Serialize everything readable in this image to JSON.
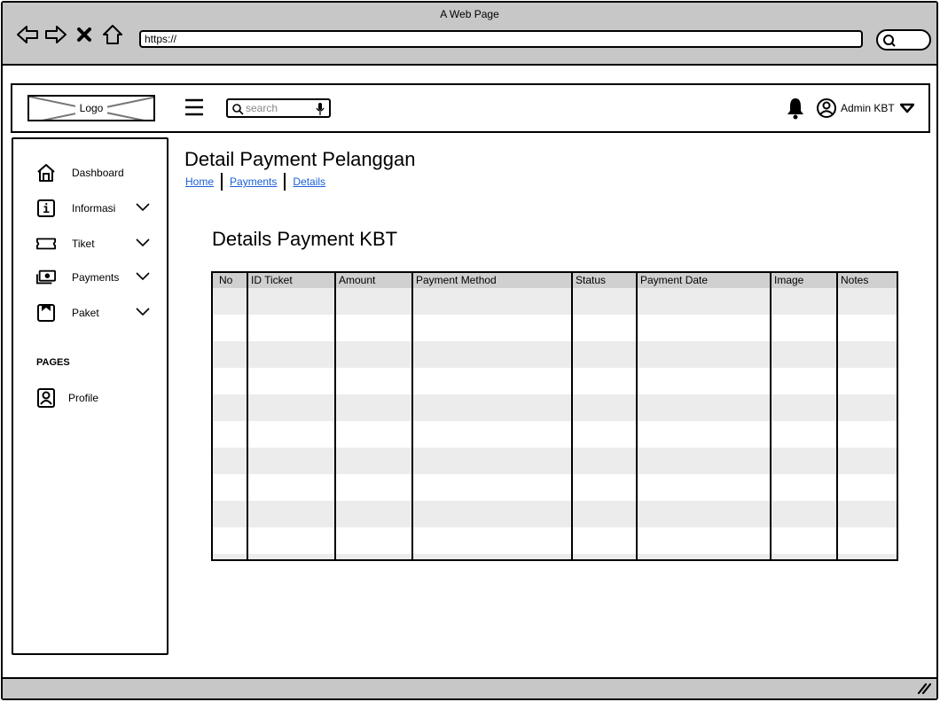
{
  "window": {
    "title": "A Web Page",
    "url": "https://"
  },
  "header": {
    "logo_text": "Logo",
    "search_placeholder": "search",
    "user_name": "Admin KBT"
  },
  "sidebar": {
    "items": [
      {
        "label": "Dashboard",
        "icon": "home-icon",
        "has_chevron": false
      },
      {
        "label": "Informasi",
        "icon": "info-icon",
        "has_chevron": true
      },
      {
        "label": "Tiket",
        "icon": "ticket-icon",
        "has_chevron": true
      },
      {
        "label": "Payments",
        "icon": "money-icon",
        "has_chevron": true
      },
      {
        "label": "Paket",
        "icon": "package-icon",
        "has_chevron": true
      }
    ],
    "pages_heading": "PAGES",
    "pages": [
      {
        "label": "Profile",
        "icon": "profile-icon"
      }
    ]
  },
  "main": {
    "title": "Detail Payment Pelanggan",
    "breadcrumb": [
      "Home",
      "Payments",
      "Details"
    ],
    "section_title": "Details Payment KBT",
    "table": {
      "columns": [
        "No",
        "ID Ticket",
        "Amount",
        "Payment Method",
        "Status",
        "Payment Date",
        "Image",
        "Notes"
      ],
      "rows": []
    }
  },
  "colors": {
    "chrome": "#c7c7c7",
    "link": "#1a5fd6",
    "table_header": "#d0d0d0",
    "row_alt": "#ececec"
  }
}
